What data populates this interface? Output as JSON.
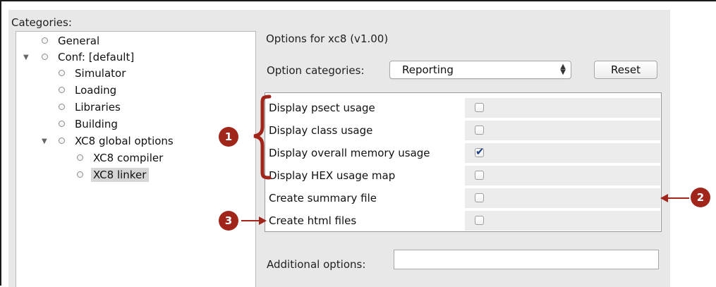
{
  "categories": {
    "label": "Categories:",
    "tree": [
      {
        "label": "General",
        "depth": 0,
        "expanded": null,
        "selected": false
      },
      {
        "label": "Conf: [default]",
        "depth": 0,
        "expanded": true,
        "selected": false
      },
      {
        "label": "Simulator",
        "depth": 1,
        "expanded": null,
        "selected": false
      },
      {
        "label": "Loading",
        "depth": 1,
        "expanded": null,
        "selected": false
      },
      {
        "label": "Libraries",
        "depth": 1,
        "expanded": null,
        "selected": false
      },
      {
        "label": "Building",
        "depth": 1,
        "expanded": null,
        "selected": false
      },
      {
        "label": "XC8 global options",
        "depth": 1,
        "expanded": true,
        "selected": false
      },
      {
        "label": "XC8 compiler",
        "depth": 2,
        "expanded": null,
        "selected": false
      },
      {
        "label": "XC8 linker",
        "depth": 2,
        "expanded": null,
        "selected": true
      }
    ]
  },
  "options": {
    "title": "Options for xc8 (v1.00)",
    "option_categories_label": "Option categories:",
    "option_categories_value": "Reporting",
    "reset_label": "Reset",
    "rows": [
      {
        "label": "Display psect usage",
        "checked": false
      },
      {
        "label": "Display class usage",
        "checked": false
      },
      {
        "label": "Display overall memory usage",
        "checked": true
      },
      {
        "label": "Display HEX usage map",
        "checked": false
      },
      {
        "label": "Create summary file",
        "checked": false
      },
      {
        "label": "Create html files",
        "checked": false
      }
    ],
    "additional_options_label": "Additional options:",
    "additional_options_value": ""
  },
  "callouts": [
    {
      "number": "1"
    },
    {
      "number": "2"
    },
    {
      "number": "3"
    }
  ],
  "colors": {
    "callout": "#a0261b",
    "checkmark": "#1b3f80",
    "dialog_bg": "#e8e8e8"
  }
}
